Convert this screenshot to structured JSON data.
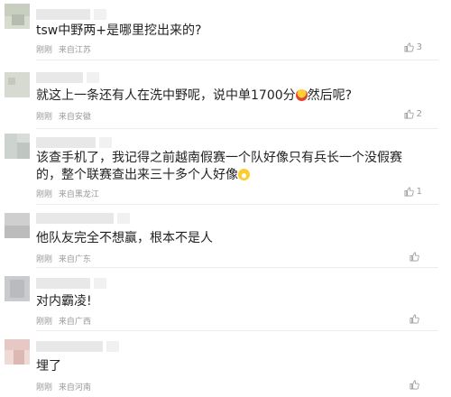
{
  "comments": [
    {
      "text": "tsw中野两+是哪里挖出来的?",
      "time": "刚刚",
      "location": "来自江苏",
      "likes": "3",
      "avatar_color": "#c9cfc0"
    },
    {
      "text": "就这上一条还有人在洗中野呢，说中单1700分",
      "text_after": "然后呢?",
      "time": "刚刚",
      "location": "来自安徽",
      "likes": "2",
      "avatar_color": "#d7dad0"
    },
    {
      "text": "该查手机了，我记得之前越南假赛一个队好像只有兵长一个没假赛的，整个联赛查出来三十多个人好像",
      "time": "刚刚",
      "location": "来自黑龙江",
      "likes": "1",
      "avatar_color": "#cdd3ce"
    },
    {
      "text": "他队友完全不想赢，根本不是人",
      "time": "刚刚",
      "location": "来自广东",
      "likes": "",
      "avatar_color": "#bcbcbc"
    },
    {
      "text": "对内霸凌!",
      "time": "刚刚",
      "location": "来自广西",
      "likes": "",
      "avatar_color": "#b9bcbe"
    },
    {
      "text": "埋了",
      "time": "刚刚",
      "location": "来自河南",
      "likes": "",
      "avatar_color": "#e6c9c4"
    }
  ],
  "icons": {
    "like": "thumbs-up-icon",
    "emoji_laugh": "laughing-face-emoji",
    "emoji_smirk": "grinning-face-emoji"
  }
}
